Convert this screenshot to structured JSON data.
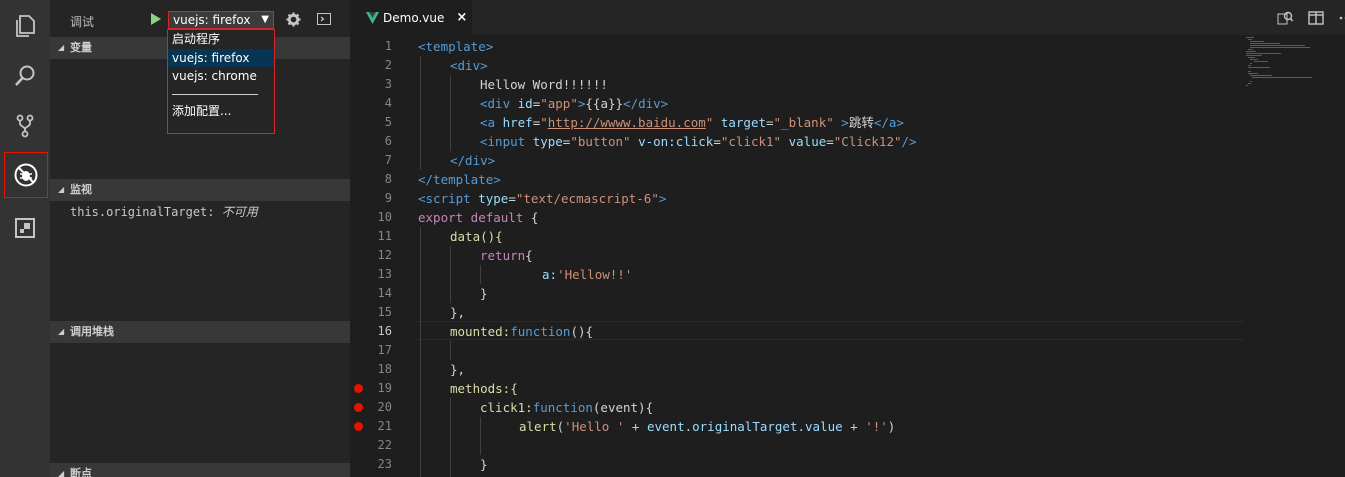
{
  "sidebar": {
    "title": "调试",
    "config_selected": "vuejs: firefox",
    "sections": {
      "variables": "变量",
      "watch": "监视",
      "callstack": "调用堆栈",
      "breakpoints": "断点"
    },
    "watch_items": [
      {
        "name": "this.originalTarget:",
        "value": "不可用"
      }
    ]
  },
  "dropdown": {
    "items": [
      "启动程序",
      "vuejs: firefox",
      "vuejs: chrome",
      "添加配置..."
    ],
    "selected_index": 1
  },
  "editor": {
    "tab": {
      "label": "Demo.vue",
      "close": "×"
    },
    "current_line": 16,
    "breakpoints": [
      19,
      20,
      21
    ],
    "lines": [
      "1",
      "2",
      "3",
      "4",
      "5",
      "6",
      "7",
      "8",
      "9",
      "10",
      "11",
      "12",
      "13",
      "14",
      "15",
      "16",
      "17",
      "18",
      "19",
      "20",
      "21",
      "22",
      "23"
    ],
    "code": {
      "l1": "<template>",
      "l2": "<div>",
      "l3": "Hellow Word!!!!!!",
      "l4_open": "<div ",
      "l4_attr": "id",
      "l4_eq": "=",
      "l4_val": "\"app\"",
      "l4_gt": ">",
      "l4_text": "{{a}}",
      "l4_close": "</div>",
      "l5_open": "<a ",
      "l5_attr1": "href",
      "l5_eq": "=",
      "l5_q1": "\"",
      "l5_url": "http://wwww.baidu.com",
      "l5_q2": "\"",
      "l5_attr2": " target",
      "l5_val2": "\"_blank\"",
      "l5_gt": " >",
      "l5_text": "跳转",
      "l5_close": "</a>",
      "l6_open": "<input ",
      "l6_attr1": "type",
      "l6_val1": "\"button\"",
      "l6_attr2": " v-on:click",
      "l6_val2": "\"click1\"",
      "l6_attr3": " value",
      "l6_val3": "\"Click12\"",
      "l6_close": "/>",
      "l7": "</div>",
      "l8": "</template>",
      "l9_open": "<script ",
      "l9_attr": "type",
      "l9_val": "\"text/ecmascript-6\"",
      "l9_gt": ">",
      "l10_kw": "export default",
      "l10_rest": " {",
      "l11": "data(){",
      "l12_kw": "return",
      "l12_rest": "{",
      "l13_key": "a:",
      "l13_val": "'Hellow!!'",
      "l14": "}",
      "l15": "},",
      "l16_key": "mounted:",
      "l16_kw": "function",
      "l16_rest": "(){",
      "l17": "",
      "l18": "},",
      "l19": "methods:{",
      "l20_key": "click1:",
      "l20_kw": "function",
      "l20_rest": "(event){",
      "l21_fn": "alert",
      "l21_p1": "(",
      "l21_s1": "'Hello '",
      "l21_mid": " + event.originalTarget.value + ",
      "l21_s2": "'!'",
      "l21_p2": ")",
      "l22": "",
      "l23": "}"
    }
  },
  "colors": {
    "activity_bar": "#333333",
    "sidebar": "#252526",
    "editor": "#1e1e1e",
    "highlight_border": "#e51400",
    "breakpoint": "#e51400",
    "run_green": "#89d185",
    "vue_green": "#41b883"
  }
}
